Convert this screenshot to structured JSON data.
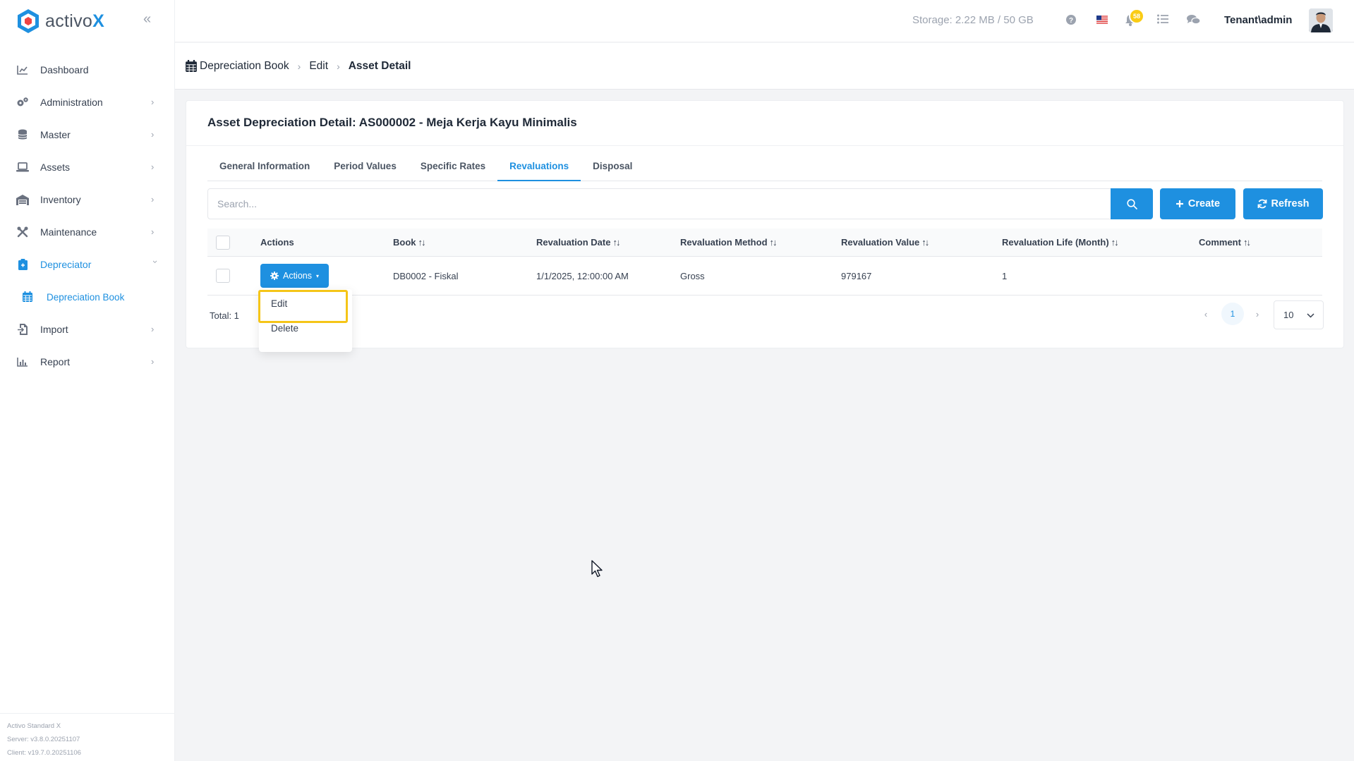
{
  "app": {
    "logo_text_main": "activo",
    "logo_text_accent": "X",
    "brand_color": "#1e90e0"
  },
  "sidebar": {
    "items": [
      {
        "label": "Dashboard",
        "icon": "chart-line-icon",
        "has_children": false
      },
      {
        "label": "Administration",
        "icon": "gears-icon",
        "has_children": true
      },
      {
        "label": "Master",
        "icon": "database-icon",
        "has_children": true
      },
      {
        "label": "Assets",
        "icon": "laptop-icon",
        "has_children": true
      },
      {
        "label": "Inventory",
        "icon": "warehouse-icon",
        "has_children": true
      },
      {
        "label": "Maintenance",
        "icon": "tools-icon",
        "has_children": true
      },
      {
        "label": "Depreciator",
        "icon": "clipboard-icon",
        "has_children": true,
        "expanded": true
      },
      {
        "label": "Import",
        "icon": "file-import-icon",
        "has_children": true
      },
      {
        "label": "Report",
        "icon": "chart-bar-icon",
        "has_children": true
      }
    ],
    "sub_item": {
      "label": "Depreciation Book",
      "icon": "calendar-icon"
    },
    "footer": {
      "product": "Activo Standard X",
      "server": "Server: v3.8.0.20251107",
      "client": "Client: v19.7.0.20251106"
    }
  },
  "topbar": {
    "storage": "Storage: 2.22 MB / 50 GB",
    "notifications_count": "58",
    "username": "Tenant\\admin"
  },
  "breadcrumb": {
    "items": [
      "Depreciation Book",
      "Edit"
    ],
    "current": "Asset Detail"
  },
  "card": {
    "title": "Asset Depreciation Detail: AS000002 - Meja Kerja Kayu Minimalis"
  },
  "tabs": [
    {
      "label": "General Information",
      "active": false
    },
    {
      "label": "Period Values",
      "active": false
    },
    {
      "label": "Specific Rates",
      "active": false
    },
    {
      "label": "Revaluations",
      "active": true
    },
    {
      "label": "Disposal",
      "active": false
    }
  ],
  "search": {
    "placeholder": "Search..."
  },
  "buttons": {
    "create": "Create",
    "refresh": "Refresh"
  },
  "table": {
    "columns": [
      "Actions",
      "Book",
      "Revaluation Date",
      "Revaluation Method",
      "Revaluation Value",
      "Revaluation Life (Month)",
      "Comment"
    ],
    "rows": [
      {
        "actions_label": "Actions",
        "book": "DB0002 - Fiskal",
        "revaluation_date": "1/1/2025, 12:00:00 AM",
        "revaluation_method": "Gross",
        "revaluation_value": "979167",
        "revaluation_life": "1",
        "comment": ""
      }
    ]
  },
  "footer": {
    "total": "Total: 1",
    "current_page": "1",
    "page_size": "10"
  },
  "dropdown": {
    "items": [
      "Edit",
      "Delete"
    ],
    "highlighted": "Edit",
    "highlight_color": "#f5c518"
  }
}
